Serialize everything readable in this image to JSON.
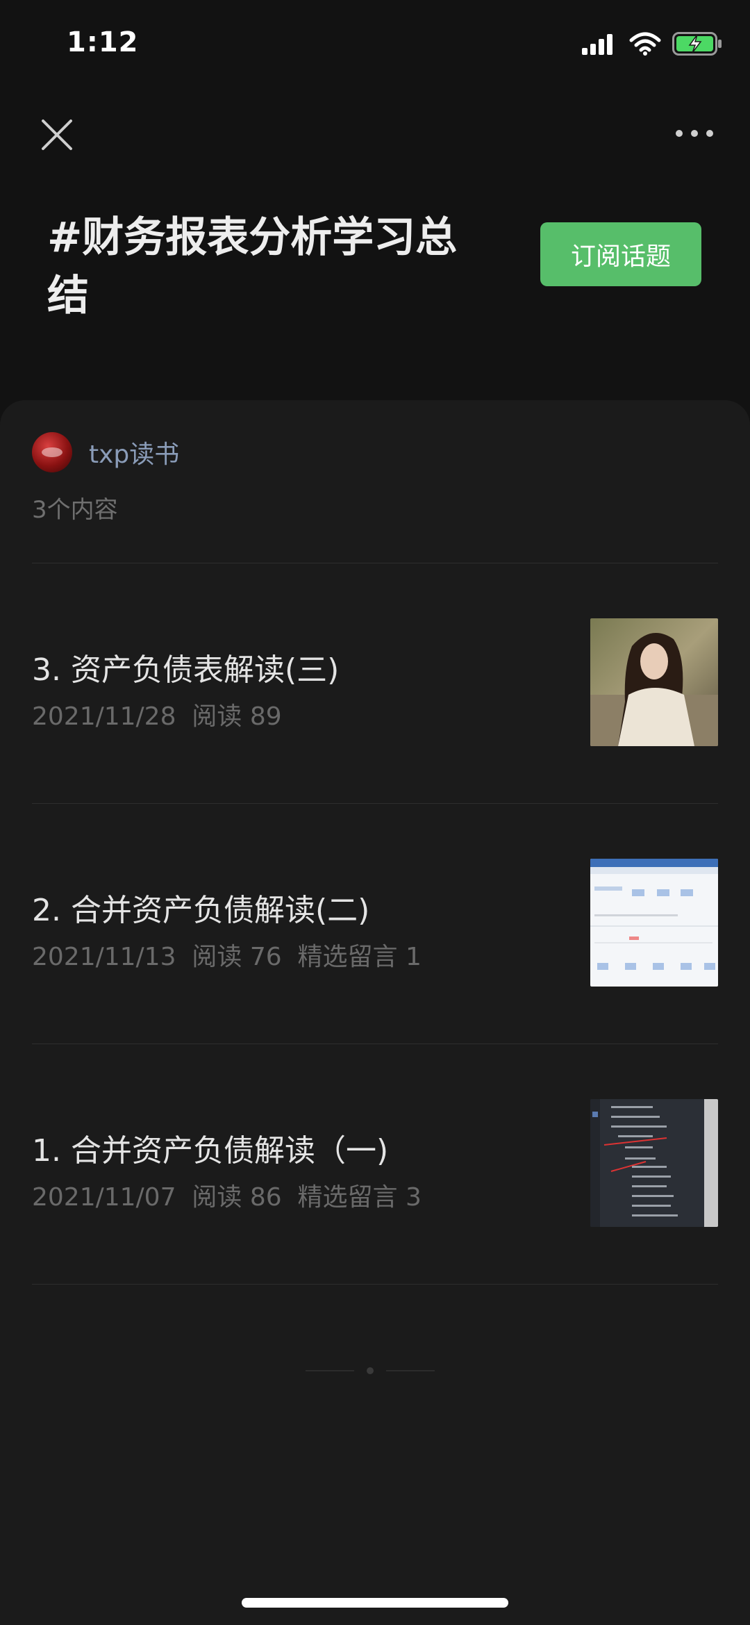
{
  "status_bar": {
    "time": "1:12"
  },
  "topic": {
    "title": "#财务报表分析学习总结",
    "subscribe_label": "订阅话题"
  },
  "author": {
    "name": "txp读书",
    "count_label": "3个内容"
  },
  "articles": [
    {
      "title": "3. 资产负债表解读(三)",
      "meta": "2021/11/28  阅读 89",
      "thumb": "photo-woman"
    },
    {
      "title": "2. 合并资产负债解读(二)",
      "meta": "2021/11/13  阅读 76  精选留言 1",
      "thumb": "screenshot-table"
    },
    {
      "title": "1. 合并资产负债解读（一)",
      "meta": "2021/11/07  阅读 86  精选留言 3",
      "thumb": "screenshot-outline"
    }
  ],
  "icons": {
    "close": "close-icon",
    "more": "more-icon",
    "signal": "signal-icon",
    "wifi": "wifi-icon",
    "battery": "battery-charging-icon"
  },
  "colors": {
    "background": "#121212",
    "card": "#1b1b1b",
    "accent_green": "#57be6a",
    "author_link": "#8a9cb8"
  }
}
